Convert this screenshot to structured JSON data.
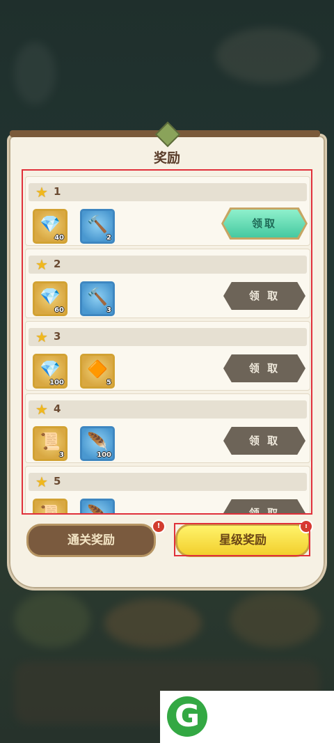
{
  "title": "奖励",
  "rewards": [
    {
      "stars": "1",
      "items": [
        {
          "icon": "crystal-ore-icon",
          "qty": "40",
          "frame": "gold"
        },
        {
          "icon": "hammer-icon",
          "qty": "2",
          "frame": "blue"
        }
      ],
      "button": "领取",
      "state": "claimable"
    },
    {
      "stars": "2",
      "items": [
        {
          "icon": "crystal-ore-icon",
          "qty": "60",
          "frame": "gold"
        },
        {
          "icon": "hammer-icon",
          "qty": "3",
          "frame": "blue"
        }
      ],
      "button": "领 取",
      "state": "locked"
    },
    {
      "stars": "3",
      "items": [
        {
          "icon": "crystal-ore-icon",
          "qty": "100",
          "frame": "gold"
        },
        {
          "icon": "amber-crystal-icon",
          "qty": "5",
          "frame": "gold"
        }
      ],
      "button": "领 取",
      "state": "locked"
    },
    {
      "stars": "4",
      "items": [
        {
          "icon": "scroll-icon",
          "qty": "3",
          "frame": "gold"
        },
        {
          "icon": "feather-icon",
          "qty": "100",
          "frame": "blue"
        }
      ],
      "button": "领 取",
      "state": "locked"
    },
    {
      "stars": "5",
      "items": [
        {
          "icon": "scroll-icon",
          "qty": "",
          "frame": "gold"
        },
        {
          "icon": "feather-icon",
          "qty": "",
          "frame": "blue"
        }
      ],
      "button": "领 取",
      "state": "locked"
    }
  ],
  "tabs": {
    "left": "通关奖励",
    "right": "星级奖励",
    "right_selected": true
  },
  "alerts": {
    "left": "!",
    "right": "!"
  },
  "colors": {
    "claim_active": "#45c9a0",
    "tab_selected": "#f2cf2d",
    "highlight": "#e0303a"
  }
}
